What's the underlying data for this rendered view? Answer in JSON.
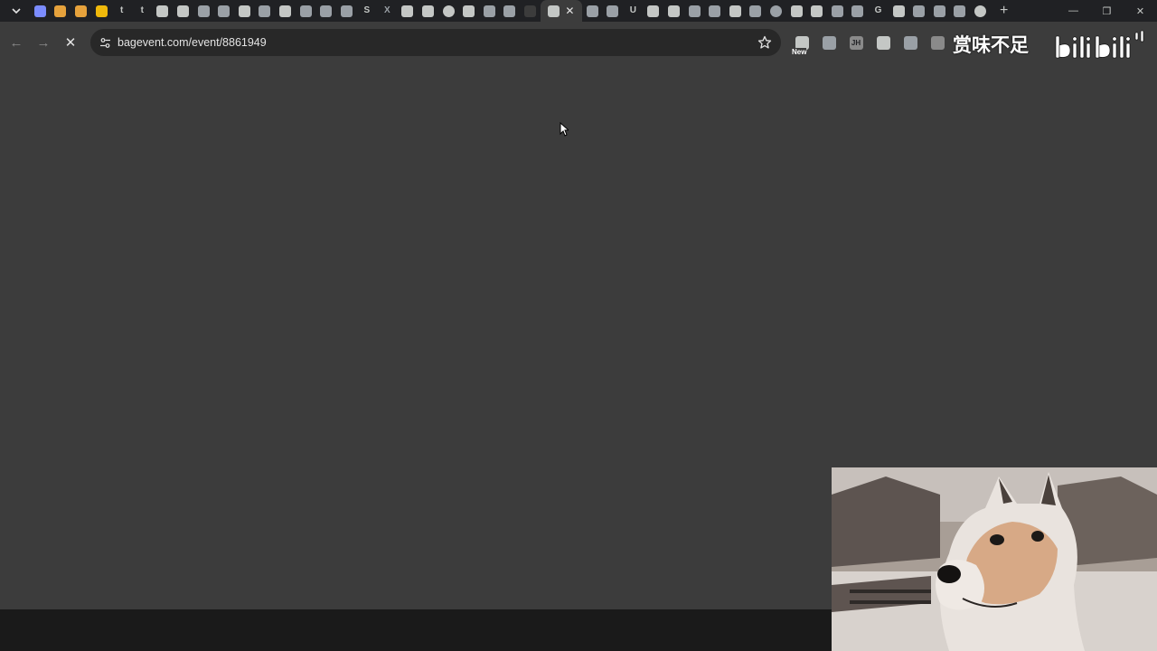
{
  "browser": {
    "address_bar": {
      "url": "bagevent.com/event/8861949"
    },
    "tabs": [
      {
        "icon": "bilibili-favicon",
        "color": "#7b8cff"
      },
      {
        "icon": "weibo-favicon",
        "color": "#e6a23c"
      },
      {
        "icon": "weibo-favicon",
        "color": "#e6a23c"
      },
      {
        "icon": "binance-favicon",
        "color": "#f0b90b"
      },
      {
        "icon": "tumblr-favicon",
        "letter": "t",
        "color": "#c4c7c5"
      },
      {
        "icon": "tumblr-favicon",
        "letter": "t",
        "color": "#c4c7c5"
      },
      {
        "icon": "calendar-favicon",
        "color": "#c4c7c5"
      },
      {
        "icon": "calendar-favicon",
        "color": "#c4c7c5"
      },
      {
        "icon": "image-favicon",
        "color": "#9aa0a6"
      },
      {
        "icon": "leaf-favicon",
        "color": "#9aa0a6"
      },
      {
        "icon": "tiktok-favicon",
        "color": "#c4c7c5"
      },
      {
        "icon": "chat-favicon",
        "color": "#9aa0a6"
      },
      {
        "icon": "news-favicon",
        "color": "#c4c7c5"
      },
      {
        "icon": "map-favicon",
        "color": "#9aa0a6"
      },
      {
        "icon": "search-favicon",
        "color": "#9aa0a6"
      },
      {
        "icon": "bird-favicon",
        "color": "#9aa0a6"
      },
      {
        "icon": "s-favicon",
        "letter": "S",
        "color": "#c4c7c5"
      },
      {
        "icon": "x-favicon",
        "letter": "X",
        "color": "#9aa0a6"
      },
      {
        "icon": "doc-favicon",
        "color": "#c4c7c5"
      },
      {
        "icon": "grid-favicon",
        "color": "#c4c7c5"
      },
      {
        "icon": "circle-favicon",
        "color": "#c4c7c5"
      },
      {
        "icon": "info-favicon",
        "color": "#c4c7c5"
      },
      {
        "icon": "puzzle-favicon",
        "color": "#9aa0a6"
      },
      {
        "icon": "rocket-favicon",
        "color": "#9aa0a6"
      },
      {
        "icon": "blank-favicon",
        "color": "#3c3c3c"
      },
      {
        "icon": "check-favicon",
        "active": true,
        "color": "#c4c7c5"
      },
      {
        "icon": "cat-favicon",
        "color": "#9aa0a6"
      },
      {
        "icon": "bug-favicon",
        "color": "#9aa0a6"
      },
      {
        "icon": "u-favicon",
        "letter": "U",
        "color": "#c4c7c5"
      },
      {
        "icon": "book-favicon",
        "color": "#c4c7c5"
      },
      {
        "icon": "at-favicon",
        "color": "#c4c7c5"
      },
      {
        "icon": "triangle-favicon",
        "color": "#9aa0a6"
      },
      {
        "icon": "diamond-favicon",
        "color": "#9aa0a6"
      },
      {
        "icon": "dice-favicon",
        "color": "#c4c7c5"
      },
      {
        "icon": "flower-favicon",
        "color": "#9aa0a6"
      },
      {
        "icon": "globe-favicon",
        "color": "#9aa0a6"
      },
      {
        "icon": "image-favicon",
        "color": "#c4c7c5"
      },
      {
        "icon": "grid-favicon",
        "color": "#c4c7c5"
      },
      {
        "icon": "history-favicon",
        "color": "#9aa0a6"
      },
      {
        "icon": "leaf-favicon",
        "color": "#9aa0a6"
      },
      {
        "icon": "g-favicon",
        "letter": "G",
        "color": "#c4c7c5"
      },
      {
        "icon": "mail-favicon",
        "color": "#c4c7c5"
      },
      {
        "icon": "grid-favicon",
        "color": "#9aa0a6"
      },
      {
        "icon": "hex-favicon",
        "color": "#9aa0a6"
      },
      {
        "icon": "gear-favicon",
        "color": "#9aa0a6"
      },
      {
        "icon": "circle-favicon",
        "color": "#c4c7c5"
      }
    ],
    "extensions": [
      {
        "icon": "new-extension-icon",
        "badge": "New"
      },
      {
        "icon": "shield-extension-icon"
      },
      {
        "icon": "jh-extension-icon",
        "label": "JH"
      },
      {
        "icon": "cloud-extension-icon"
      },
      {
        "icon": "sparkle-extension-icon"
      },
      {
        "icon": "k-extension-icon"
      }
    ]
  },
  "overlay": {
    "watermark_text": "赏味不足",
    "platform_logo": "bilibili"
  },
  "colors": {
    "tabstrip_bg": "#202124",
    "toolbar_bg": "#3c3c3c",
    "omnibox_bg": "#282828",
    "page_bg": "#3c3c3c"
  }
}
